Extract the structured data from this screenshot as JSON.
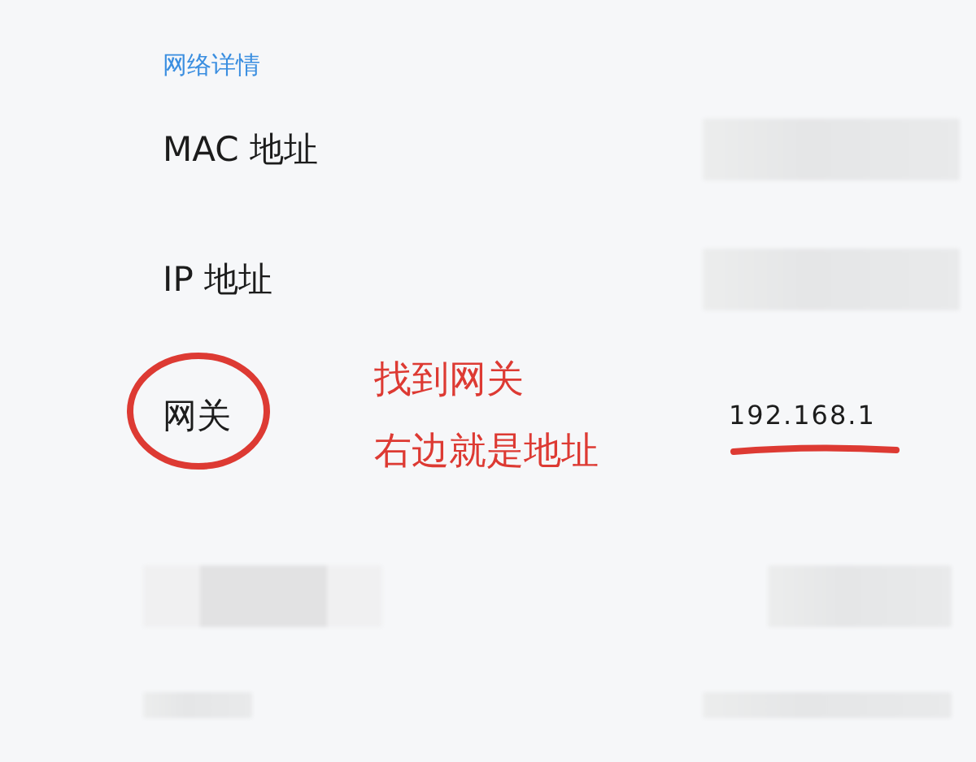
{
  "section_title": "网络详情",
  "rows": [
    {
      "kind": "redacted-field",
      "label": "MAC 地址"
    },
    {
      "kind": "redacted-field",
      "label": "IP 地址"
    },
    {
      "kind": "field",
      "label": "网关",
      "value": "192.168.1",
      "circled": true,
      "underlined": true,
      "note_lines": [
        "找到网关",
        "右边就是地址"
      ]
    },
    {
      "kind": "blurred"
    },
    {
      "kind": "blurred-thin"
    }
  ]
}
